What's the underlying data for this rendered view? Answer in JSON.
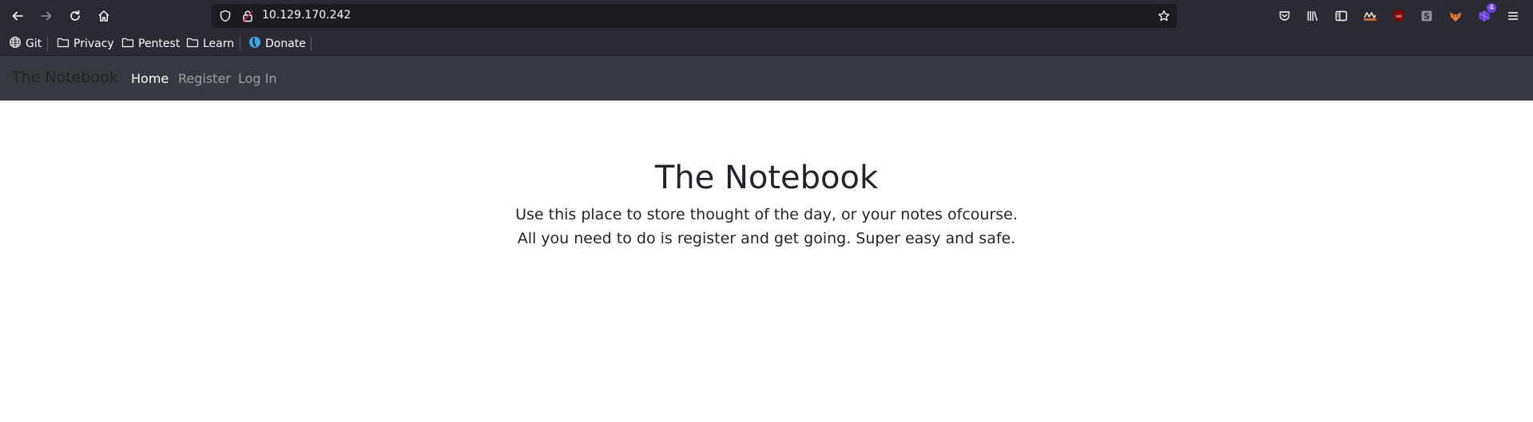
{
  "browser": {
    "url": "10.129.170.242",
    "icons": {
      "back": "back-arrow-icon",
      "forward": "forward-arrow-icon",
      "reload": "reload-icon",
      "home": "home-icon",
      "shield": "tracking-protection-shield-icon",
      "lock": "insecure-lock-icon",
      "bookmark_star": "bookmark-star-icon",
      "pocket": "pocket-icon",
      "library": "library-icon",
      "sidebar": "sidebar-icon",
      "ublock": "ublock-origin-icon",
      "menu": "hamburger-menu-icon"
    },
    "extension_badge": "4"
  },
  "bookmarks": [
    {
      "label": "Git",
      "icon": "globe-icon"
    },
    {
      "label": "Privacy",
      "icon": "folder-icon"
    },
    {
      "label": "Pentest",
      "icon": "folder-icon"
    },
    {
      "label": "Learn",
      "icon": "folder-icon"
    },
    {
      "label": "Donate",
      "icon": "donate-favicon"
    }
  ],
  "navbar": {
    "brand": "The Notebook",
    "links": [
      {
        "label": "Home",
        "active": true
      },
      {
        "label": "Register",
        "active": false
      },
      {
        "label": "Log In",
        "active": false
      }
    ]
  },
  "hero": {
    "title": "The Notebook",
    "line1": "Use this place to store thought of the day, or your notes ofcourse.",
    "line2": "All you need to do is register and get going. Super easy and safe."
  },
  "colors": {
    "browser_chrome": "#2b2a33",
    "url_field": "#1c1b22",
    "navbar_bg": "#343a40",
    "page_text": "#212529"
  }
}
